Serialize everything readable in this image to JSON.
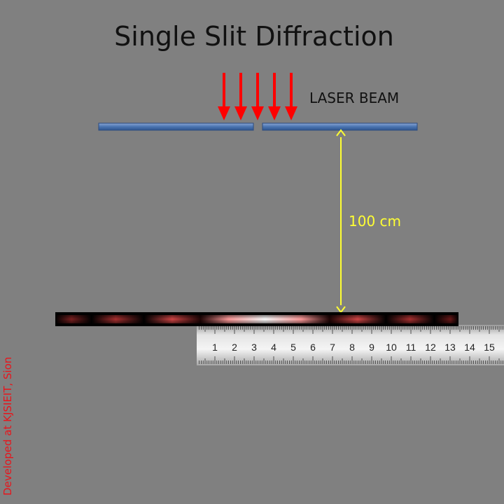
{
  "title": "Single Slit Diffraction",
  "beam_label": "LASER BEAM",
  "distance_label": "100 cm",
  "credit": "Developed at KJSIEIT, Sion",
  "ruler": {
    "numbers": [
      "1",
      "2",
      "3",
      "4",
      "5",
      "6",
      "7",
      "8",
      "9",
      "10",
      "11",
      "12",
      "13",
      "14",
      "15"
    ]
  },
  "colors": {
    "background": "#808080",
    "laser_arrow": "#ff0000",
    "slit_plate": "#4a74b0",
    "distance_arrow": "#ffff33",
    "credit": "#e8141b"
  }
}
